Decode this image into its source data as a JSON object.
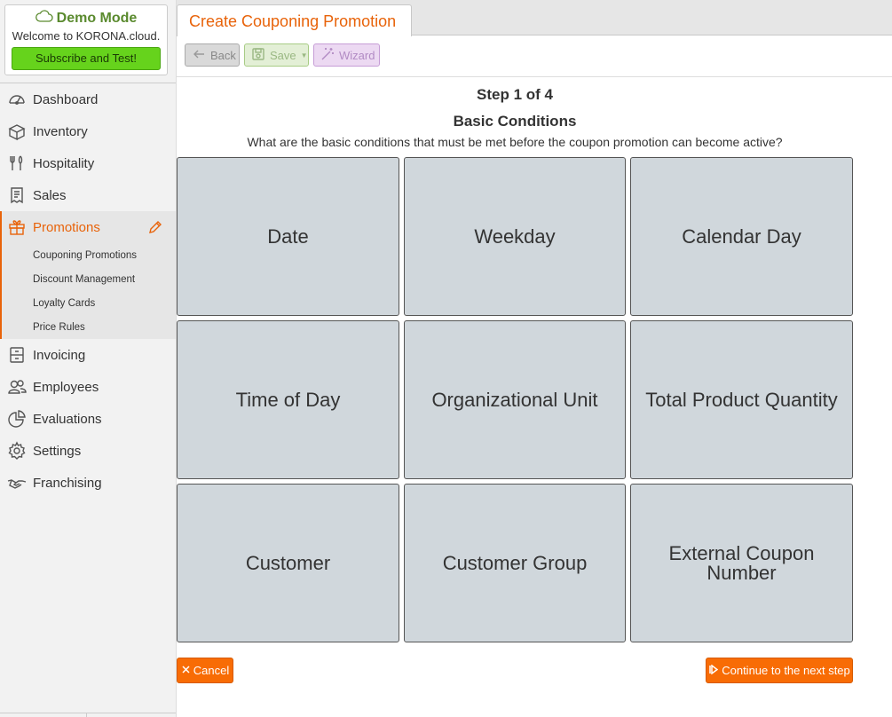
{
  "demo": {
    "title": "Demo Mode",
    "welcome": "Welcome to KORONA.cloud.",
    "subscribe_label": "Subscribe and Test!"
  },
  "sidebar": {
    "items": [
      {
        "label": "Dashboard",
        "icon": "dashboard-icon"
      },
      {
        "label": "Inventory",
        "icon": "inventory-icon"
      },
      {
        "label": "Hospitality",
        "icon": "hospitality-icon"
      },
      {
        "label": "Sales",
        "icon": "sales-icon"
      },
      {
        "label": "Promotions",
        "icon": "gift-icon",
        "active": true
      },
      {
        "label": "Invoicing",
        "icon": "invoicing-icon"
      },
      {
        "label": "Employees",
        "icon": "employees-icon"
      },
      {
        "label": "Evaluations",
        "icon": "evaluations-icon"
      },
      {
        "label": "Settings",
        "icon": "settings-icon"
      },
      {
        "label": "Franchising",
        "icon": "handshake-icon"
      }
    ],
    "promotions_sub": [
      "Couponing Promotions",
      "Discount Management",
      "Loyalty Cards",
      "Price Rules"
    ]
  },
  "tab": {
    "title": "Create Couponing Promotion"
  },
  "toolbar": {
    "back_label": "Back",
    "save_label": "Save",
    "wizard_label": "Wizard"
  },
  "wizard": {
    "step": "Step 1 of 4",
    "title": "Basic Conditions",
    "question": "What are the basic conditions that must be met before the coupon promotion can become active?",
    "conditions": [
      "Date",
      "Weekday",
      "Calendar Day",
      "Time of Day",
      "Organizational Unit",
      "Total Product Quantity",
      "Customer",
      "Customer Group",
      "External Coupon Number"
    ]
  },
  "actions": {
    "cancel_label": "Cancel",
    "next_label": "Continue to the next step"
  },
  "colors": {
    "accent": "#e8630a",
    "button_orange": "#f86c05",
    "subscribe_green": "#66d31c",
    "tile_bg": "#d0d7dc"
  }
}
